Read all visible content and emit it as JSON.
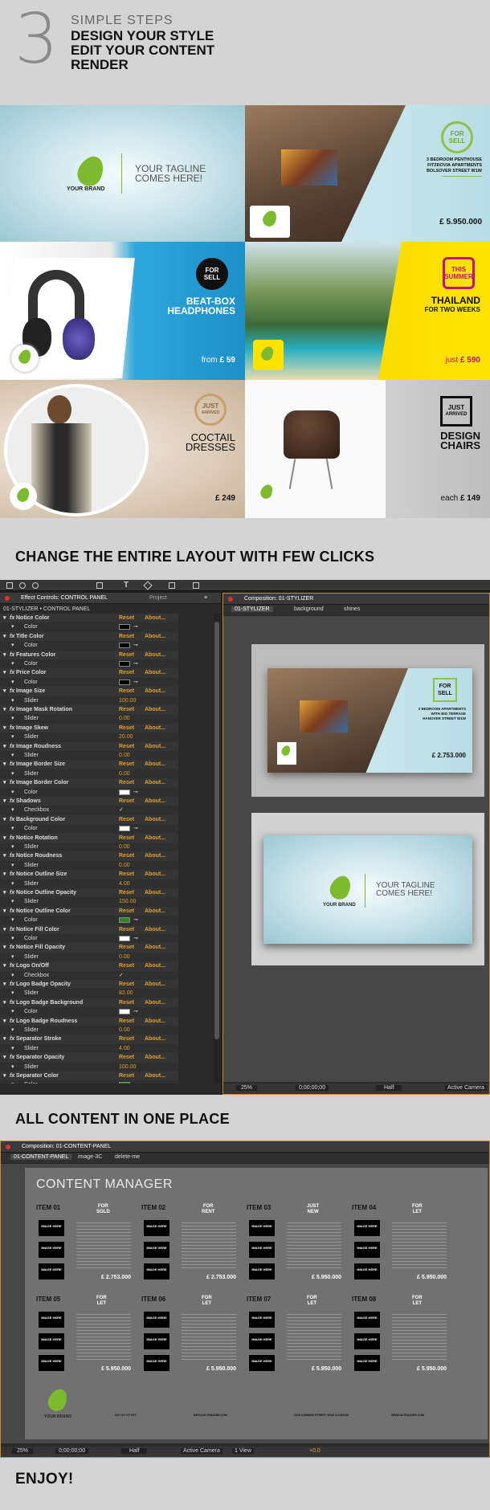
{
  "header": {
    "number": "3",
    "title": "SIMPLE STEPS",
    "steps": [
      "DESIGN YOUR STYLE",
      "EDIT YOUR CONTENT",
      "RENDER"
    ]
  },
  "showcase": {
    "brand": "YOUR BRAND",
    "tagline": [
      "YOUR TAGLINE",
      "COMES HERE!"
    ],
    "penthouse": {
      "badge": [
        "FOR",
        "SELL"
      ],
      "title": [
        "3 BEDROOM PENTHOUSE",
        "FITZROVIA APARTMENTS",
        "BOLSOVER STREET W1W"
      ],
      "price": "£ 5.950.000"
    },
    "headphones": {
      "badge": [
        "FOR",
        "SELL"
      ],
      "title": [
        "BEAT-BOX",
        "HEADPHONES"
      ],
      "price_prefix": "from",
      "price": "£ 59"
    },
    "thailand": {
      "badge": [
        "THIS",
        "SUMMER"
      ],
      "title": [
        "THAILAND",
        "FOR TWO WEEKS"
      ],
      "price_prefix": "just",
      "price": "£ 590"
    },
    "dresses": {
      "badge": [
        "JUST",
        "ARRIVED"
      ],
      "title": [
        "COCTAIL",
        "DRESSES"
      ],
      "price": "£ 249"
    },
    "chairs": {
      "badge": [
        "JUST",
        "ARRIVED"
      ],
      "title": [
        "DESIGN",
        "CHAIRS"
      ],
      "price_prefix": "each",
      "price": "£ 149"
    }
  },
  "section1": {
    "heading": "CHANGE THE ENTIRE LAYOUT WITH FEW CLICKS"
  },
  "effect_panel": {
    "tab": "Effect Controls: CONTROL PANEL",
    "tab2": "Project",
    "path": "01-STYLIZER • CONTROL PANEL",
    "reset": "Reset",
    "about": "About...",
    "rows": [
      {
        "kind": "fx",
        "name": "Notice Color"
      },
      {
        "kind": "sub",
        "name": "Color",
        "color": "#000000"
      },
      {
        "kind": "fx",
        "name": "Title Color"
      },
      {
        "kind": "sub",
        "name": "Color",
        "color": "#000000"
      },
      {
        "kind": "fx",
        "name": "Features Color"
      },
      {
        "kind": "sub",
        "name": "Color",
        "color": "#000000"
      },
      {
        "kind": "fx",
        "name": "Price Color"
      },
      {
        "kind": "sub",
        "name": "Color",
        "color": "#000000"
      },
      {
        "kind": "fx",
        "name": "Image Size"
      },
      {
        "kind": "sub",
        "name": "Slider",
        "value": "100.00"
      },
      {
        "kind": "fx",
        "name": "Image Mask Rotation"
      },
      {
        "kind": "sub",
        "name": "Slider",
        "value": "0.00"
      },
      {
        "kind": "fx",
        "name": "Image Skew"
      },
      {
        "kind": "sub",
        "name": "Slider",
        "value": "20.00"
      },
      {
        "kind": "fx",
        "name": "Image Roudness"
      },
      {
        "kind": "sub",
        "name": "Slider",
        "value": "0.00"
      },
      {
        "kind": "fx",
        "name": "Image Border Size"
      },
      {
        "kind": "sub",
        "name": "Slider",
        "value": "0.00"
      },
      {
        "kind": "fx",
        "name": "Image Border Color"
      },
      {
        "kind": "sub",
        "name": "Color",
        "color": "#ffffff"
      },
      {
        "kind": "fx",
        "name": "Shadows"
      },
      {
        "kind": "sub",
        "name": "Checkbox",
        "check": "✓"
      },
      {
        "kind": "fx",
        "name": "Background Color"
      },
      {
        "kind": "sub",
        "name": "Color",
        "color": "#ffffff"
      },
      {
        "kind": "fx",
        "name": "Notice Rotation"
      },
      {
        "kind": "sub",
        "name": "Slider",
        "value": "0.00"
      },
      {
        "kind": "fx",
        "name": "Notice Roudness"
      },
      {
        "kind": "sub",
        "name": "Slider",
        "value": "0.00"
      },
      {
        "kind": "fx",
        "name": "Notice Outline Size"
      },
      {
        "kind": "sub",
        "name": "Slider",
        "value": "4.00"
      },
      {
        "kind": "fx",
        "name": "Notice Outline Opacity"
      },
      {
        "kind": "sub",
        "name": "Slider",
        "value": "150.00"
      },
      {
        "kind": "fx",
        "name": "Notice Outline Color"
      },
      {
        "kind": "sub",
        "name": "Color",
        "color": "#2a8a20"
      },
      {
        "kind": "fx",
        "name": "Notice Fill Color"
      },
      {
        "kind": "sub",
        "name": "Color",
        "color": "#ffffff"
      },
      {
        "kind": "fx",
        "name": "Notice Fill Opacity"
      },
      {
        "kind": "sub",
        "name": "Slider",
        "value": "0.00"
      },
      {
        "kind": "fx",
        "name": "Logo On/Off"
      },
      {
        "kind": "sub",
        "name": "Checkbox",
        "check": "✓"
      },
      {
        "kind": "fx",
        "name": "Logo Badge Opacity"
      },
      {
        "kind": "sub",
        "name": "Slider",
        "value": "82.00"
      },
      {
        "kind": "fx",
        "name": "Logo Badge Background"
      },
      {
        "kind": "sub",
        "name": "Color",
        "color": "#ffffff"
      },
      {
        "kind": "fx",
        "name": "Logo Badge Roudness"
      },
      {
        "kind": "sub",
        "name": "Slider",
        "value": "0.00"
      },
      {
        "kind": "fx",
        "name": "Separator Stroke"
      },
      {
        "kind": "sub",
        "name": "Slider",
        "value": "4.00"
      },
      {
        "kind": "fx",
        "name": "Separator Opacity"
      },
      {
        "kind": "sub",
        "name": "Slider",
        "value": "100.00"
      },
      {
        "kind": "fx",
        "name": "Separator Color"
      },
      {
        "kind": "sub",
        "name": "Color",
        "color": "#2a8a20"
      }
    ]
  },
  "composition1": {
    "tab": "Composition: 01-STYLIZER",
    "crumbs": [
      "01-STYLIZER",
      "background",
      "shines"
    ],
    "preview1": {
      "badge": [
        "FOR",
        "SELL"
      ],
      "title": [
        "2 BEDROOM APARTMENTS",
        "WITH BIG TERRASE",
        "HANOVER STREET W1W"
      ],
      "price": "£ 2.753.000"
    },
    "preview2": {
      "tagline": [
        "YOUR TAGLINE",
        "COMES HERE!"
      ],
      "brand": "YOUR BRAND"
    },
    "zoom": "25%",
    "timecode": "0;00;00;00",
    "resolution": "Half",
    "camera": "Active Camera"
  },
  "section2": {
    "heading": "ALL CONTENT IN ONE PLACE"
  },
  "composition2": {
    "tab": "Composition: 01-CONTENT-PANEL",
    "crumbs": [
      "01-CONTENT-PANEL",
      "image-3C",
      "delete-me"
    ],
    "title": "CONTENT MANAGER",
    "image_label": [
      "IMAGE",
      "HERE"
    ],
    "items": [
      {
        "id": "ITEM 01",
        "notice": [
          "FOR",
          "SOLD"
        ],
        "price": "£ 2.753.000"
      },
      {
        "id": "ITEM 02",
        "notice": [
          "FOR",
          "RENT"
        ],
        "price": "£ 2.753.000"
      },
      {
        "id": "ITEM 03",
        "notice": [
          "JUST",
          "NEW"
        ],
        "price": "£ 5.950.000"
      },
      {
        "id": "ITEM 04",
        "notice": [
          "FOR",
          "LET"
        ],
        "price": "£ 5.950.000"
      },
      {
        "id": "ITEM 05",
        "notice": [
          "FOR",
          "LET"
        ],
        "price": "£ 5.950.000"
      },
      {
        "id": "ITEM 06",
        "notice": [
          "FOR",
          "LET"
        ],
        "price": "£ 5.950.000"
      },
      {
        "id": "ITEM 07",
        "notice": [
          "FOR",
          "LET"
        ],
        "price": "£ 5.950.000"
      },
      {
        "id": "ITEM 08",
        "notice": [
          "FOR",
          "LET"
        ],
        "price": "£ 5.950.000"
      }
    ],
    "brand": "YOUR BRAND",
    "contact": [
      "020 757 077 607",
      "INFO@ULTRA2DER.COM",
      "2225 COMMON STREET, W1W 1LONDON",
      "WWW.ULTRA2DER.COM"
    ],
    "zoom": "25%",
    "timecode": "0;00;00;00",
    "resolution": "Half",
    "camera": "Active Camera",
    "view": "1 View",
    "exposure": "+0.0"
  },
  "footer": {
    "text": "ENJOY!"
  }
}
